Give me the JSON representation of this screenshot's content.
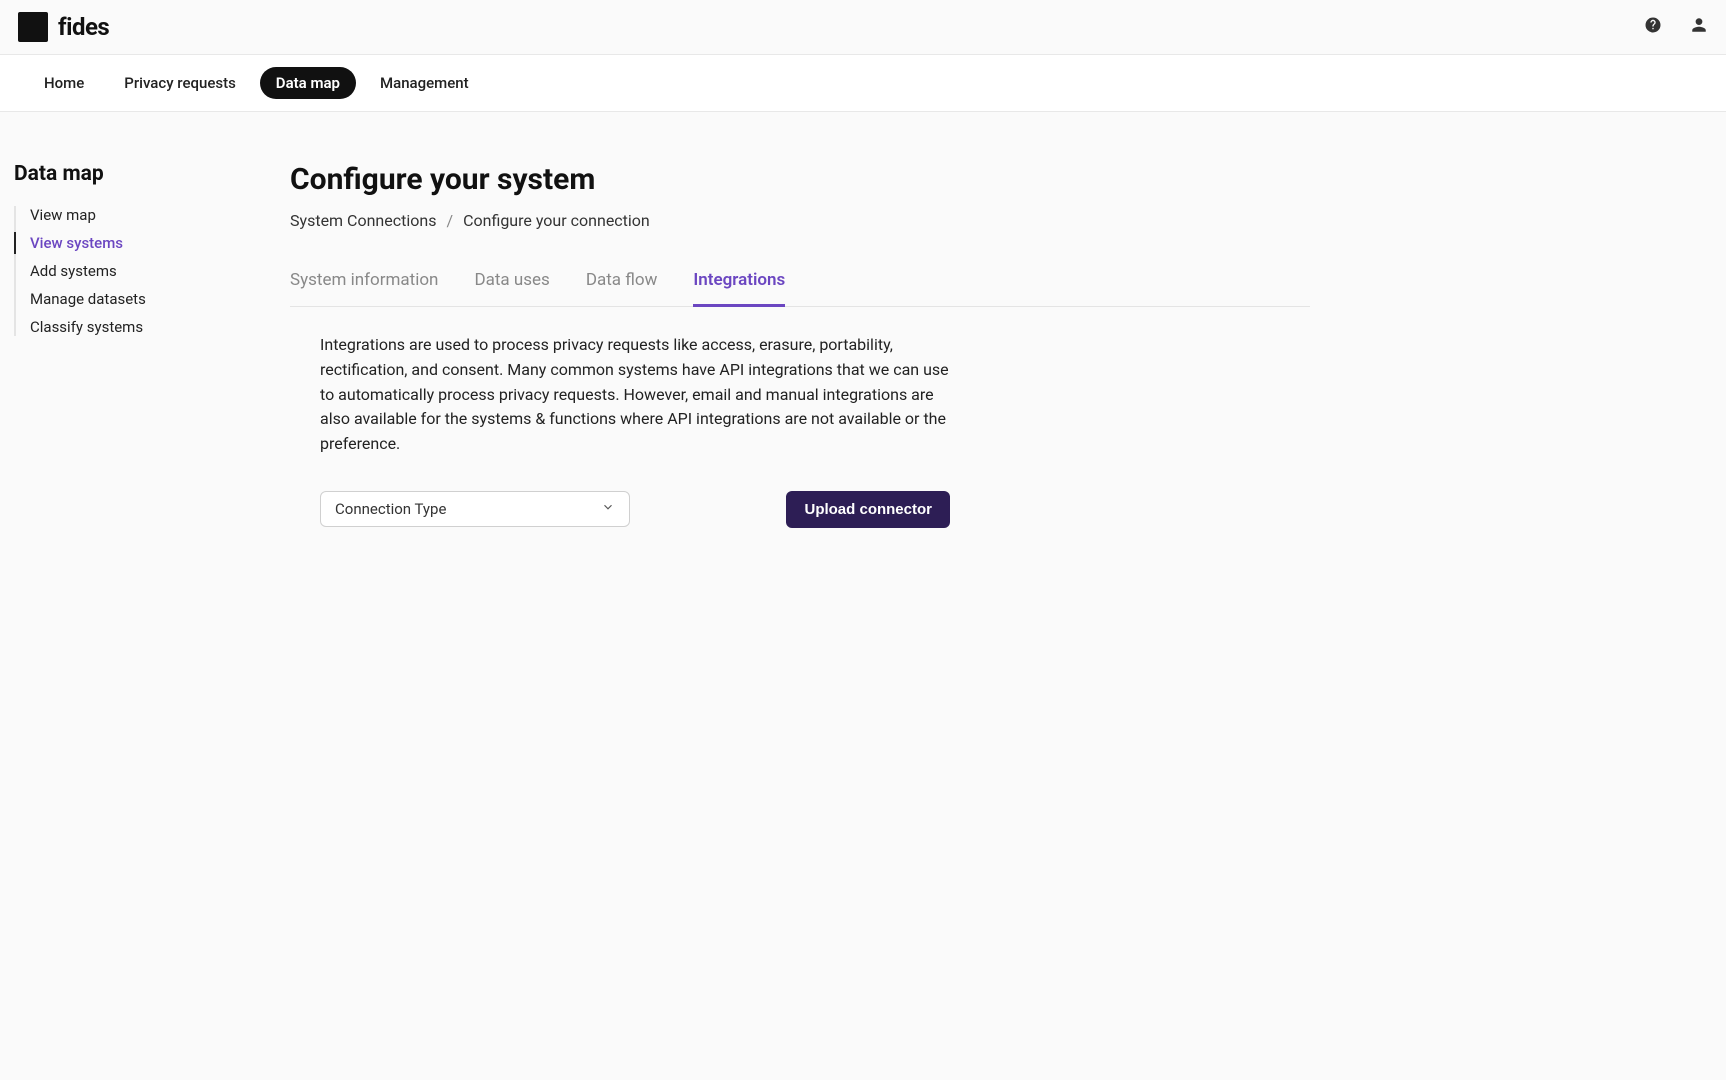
{
  "brand": {
    "name": "fides"
  },
  "header_nav": {
    "items": [
      {
        "label": "Home",
        "active": false
      },
      {
        "label": "Privacy requests",
        "active": false
      },
      {
        "label": "Data map",
        "active": true
      },
      {
        "label": "Management",
        "active": false
      }
    ]
  },
  "sidebar": {
    "title": "Data map",
    "items": [
      {
        "label": "View map",
        "active": false
      },
      {
        "label": "View systems",
        "active": true
      },
      {
        "label": "Add systems",
        "active": false
      },
      {
        "label": "Manage datasets",
        "active": false
      },
      {
        "label": "Classify systems",
        "active": false
      }
    ]
  },
  "page": {
    "title": "Configure your system",
    "breadcrumb": {
      "item1": "System Connections",
      "sep": "/",
      "item2": "Configure your connection"
    }
  },
  "content_tabs": {
    "items": [
      {
        "label": "System information",
        "active": false
      },
      {
        "label": "Data uses",
        "active": false
      },
      {
        "label": "Data flow",
        "active": false
      },
      {
        "label": "Integrations",
        "active": true
      }
    ]
  },
  "integrations": {
    "description": "Integrations are used to process privacy requests like access, erasure, portability, rectification, and consent. Many common systems have API integrations that we can use to automatically process privacy requests. However, email and manual integrations are also available for the systems & functions where API integrations are not available or the preference.",
    "select_label": "Connection Type",
    "upload_button": "Upload connector"
  }
}
